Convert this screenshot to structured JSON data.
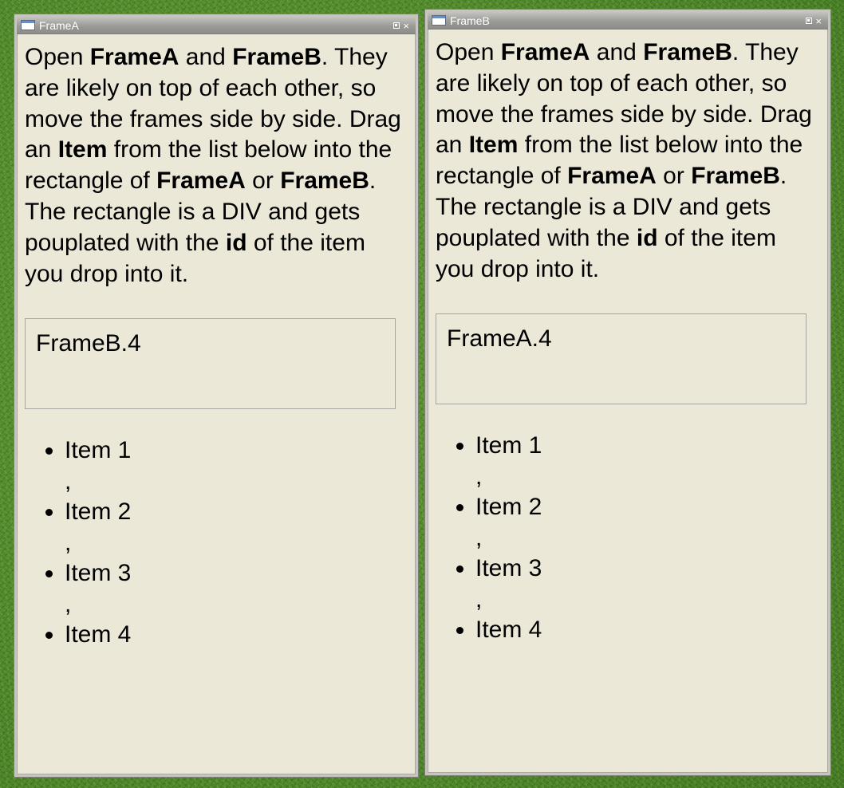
{
  "frames": [
    {
      "title": "FrameA",
      "instructions": [
        {
          "t": "Open ",
          "b": false
        },
        {
          "t": "FrameA",
          "b": true
        },
        {
          "t": " and ",
          "b": false
        },
        {
          "t": "FrameB",
          "b": true
        },
        {
          "t": ". They are likely on top of each other, so move the frames side by side. Drag an ",
          "b": false
        },
        {
          "t": "Item",
          "b": true
        },
        {
          "t": " from the list below into the rectangle of ",
          "b": false
        },
        {
          "t": "FrameA",
          "b": true
        },
        {
          "t": " or ",
          "b": false
        },
        {
          "t": "FrameB",
          "b": true
        },
        {
          "t": ". The rectangle is a DIV and gets pouplated with the ",
          "b": false
        },
        {
          "t": "id",
          "b": true
        },
        {
          "t": " of the item you drop into it.",
          "b": false
        }
      ],
      "drop_target_value": "FrameB.4",
      "items": [
        "Item 1",
        "Item 2",
        "Item 3",
        "Item 4"
      ],
      "item_separator": ","
    },
    {
      "title": "FrameB",
      "instructions": [
        {
          "t": "Open ",
          "b": false
        },
        {
          "t": "FrameA",
          "b": true
        },
        {
          "t": " and ",
          "b": false
        },
        {
          "t": "FrameB",
          "b": true
        },
        {
          "t": ". They are likely on top of each other, so move the frames side by side. Drag an ",
          "b": false
        },
        {
          "t": "Item",
          "b": true
        },
        {
          "t": " from the list below into the rectangle of ",
          "b": false
        },
        {
          "t": "FrameA",
          "b": true
        },
        {
          "t": " or ",
          "b": false
        },
        {
          "t": "FrameB",
          "b": true
        },
        {
          "t": ". The rectangle is a DIV and gets pouplated with the ",
          "b": false
        },
        {
          "t": "id",
          "b": true
        },
        {
          "t": " of the item you drop into it.",
          "b": false
        }
      ],
      "drop_target_value": "FrameA.4",
      "items": [
        "Item 1",
        "Item 2",
        "Item 3",
        "Item 4"
      ],
      "item_separator": ","
    }
  ],
  "icons": {
    "window": "window-icon",
    "restore": "restore-icon",
    "close": "close-icon",
    "close_glyph": "×"
  },
  "colors": {
    "frame_background": "#ebe8d8",
    "titlebar_top": "#c4c4c0",
    "titlebar_bottom": "#8c8c88",
    "desktop_grass": "#4f8a2a"
  }
}
